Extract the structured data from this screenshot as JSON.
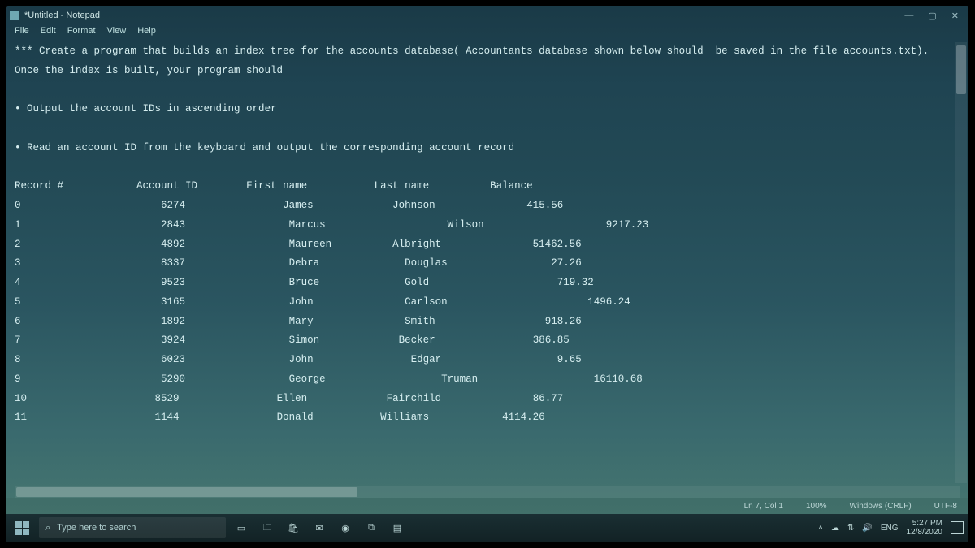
{
  "window": {
    "title": "*Untitled - Notepad",
    "controls": {
      "min": "—",
      "max": "▢",
      "close": "✕"
    }
  },
  "menu": [
    "File",
    "Edit",
    "Format",
    "View",
    "Help"
  ],
  "content": {
    "line1": "*** Create a program that builds an index tree for the accounts database( Accountants database shown below should  be saved in the file accounts.txt).",
    "line2": "Once the index is built, your program should",
    "bullet1": "Output the account IDs in ascending order",
    "bullet2": "Read an account ID from the keyboard and output the corresponding account record",
    "headers": {
      "c0": "Record #",
      "c1": "Account ID",
      "c2": "First name",
      "c3": "Last name",
      "c4": "Balance"
    },
    "rows": [
      {
        "rec": "0",
        "id": "6274",
        "first": "James",
        "last": "Johnson",
        "bal": "415.56"
      },
      {
        "rec": "1",
        "id": "2843",
        "first": "Marcus",
        "last": "Wilson",
        "bal": "9217.23"
      },
      {
        "rec": "2",
        "id": "4892",
        "first": "Maureen",
        "last": "Albright",
        "bal": "51462.56"
      },
      {
        "rec": "3",
        "id": "8337",
        "first": "Debra",
        "last": "Douglas",
        "bal": "27.26"
      },
      {
        "rec": "4",
        "id": "9523",
        "first": "Bruce",
        "last": "Gold",
        "bal": "719.32"
      },
      {
        "rec": "5",
        "id": "3165",
        "first": "John",
        "last": "Carlson",
        "bal": "1496.24"
      },
      {
        "rec": "6",
        "id": "1892",
        "first": "Mary",
        "last": "Smith",
        "bal": "918.26"
      },
      {
        "rec": "7",
        "id": "3924",
        "first": "Simon",
        "last": "Becker",
        "bal": "386.85"
      },
      {
        "rec": "8",
        "id": "6023",
        "first": "John",
        "last": "Edgar",
        "bal": "9.65"
      },
      {
        "rec": "9",
        "id": "5290",
        "first": "George",
        "last": "Truman",
        "bal": "16110.68"
      },
      {
        "rec": "10",
        "id": "8529",
        "first": "Ellen",
        "last": "Fairchild",
        "bal": "86.77"
      },
      {
        "rec": "11",
        "id": "1144",
        "first": "Donald",
        "last": "Williams",
        "bal": "4114.26"
      }
    ]
  },
  "status": {
    "pos": "Ln 7, Col 1",
    "zoom": "100%",
    "eol": "Windows (CRLF)",
    "enc": "UTF-8"
  },
  "taskbar": {
    "search_placeholder": "Type here to search",
    "lang": "ENG",
    "time": "5:27 PM",
    "date": "12/8/2020"
  }
}
